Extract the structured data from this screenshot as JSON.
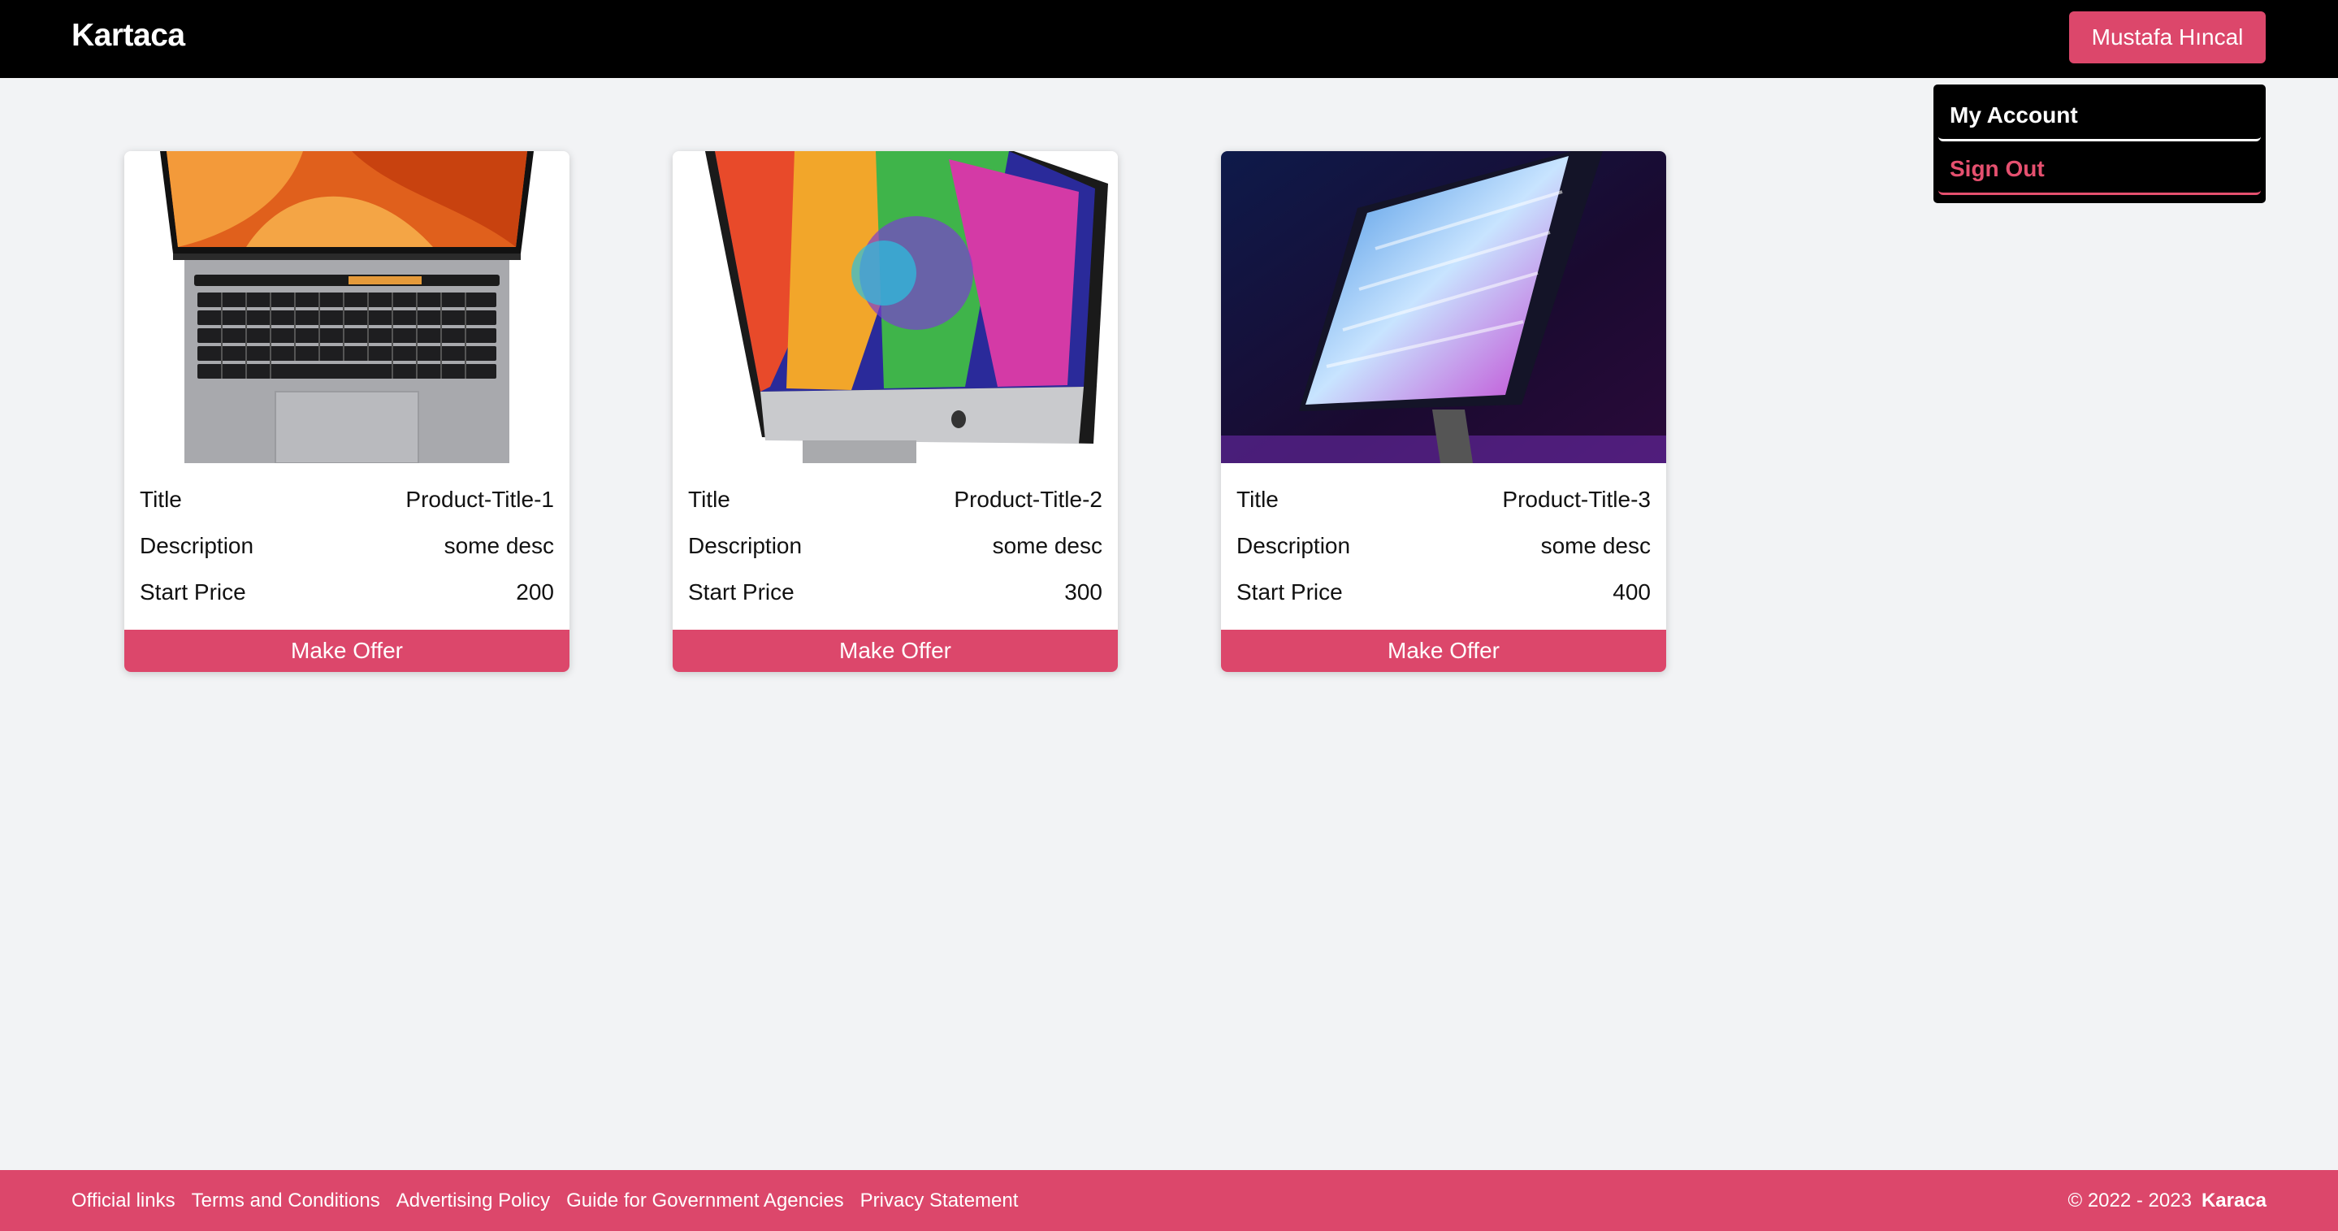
{
  "header": {
    "logo": "Kartaca",
    "user_button": "Mustafa Hıncal"
  },
  "dropdown": {
    "items": [
      {
        "label": "My Account"
      },
      {
        "label": "Sign Out"
      }
    ]
  },
  "colors": {
    "accent": "#dc476b",
    "header_bg": "#000000",
    "page_bg": "#f2f3f5",
    "signout_text": "#e5506f"
  },
  "products": [
    {
      "image_icon": "laptop-image",
      "title_label": "Title",
      "title": "Product-Title-1",
      "desc_label": "Description",
      "description": "some desc",
      "price_label": "Start Price",
      "price": "200",
      "button": "Make Offer"
    },
    {
      "image_icon": "desktop-monitor-image",
      "title_label": "Title",
      "title": "Product-Title-2",
      "desc_label": "Description",
      "description": "some desc",
      "price_label": "Start Price",
      "price": "300",
      "button": "Make Offer"
    },
    {
      "image_icon": "display-monitor-image",
      "title_label": "Title",
      "title": "Product-Title-3",
      "desc_label": "Description",
      "description": "some desc",
      "price_label": "Start Price",
      "price": "400",
      "button": "Make Offer"
    }
  ],
  "footer": {
    "links": [
      {
        "label": "Official links"
      },
      {
        "label": "Terms and Conditions"
      },
      {
        "label": "Advertising Policy"
      },
      {
        "label": "Guide for Government Agencies"
      },
      {
        "label": "Privacy Statement"
      }
    ],
    "copyright": "© 2022 - 2023",
    "brand": "Karaca"
  }
}
